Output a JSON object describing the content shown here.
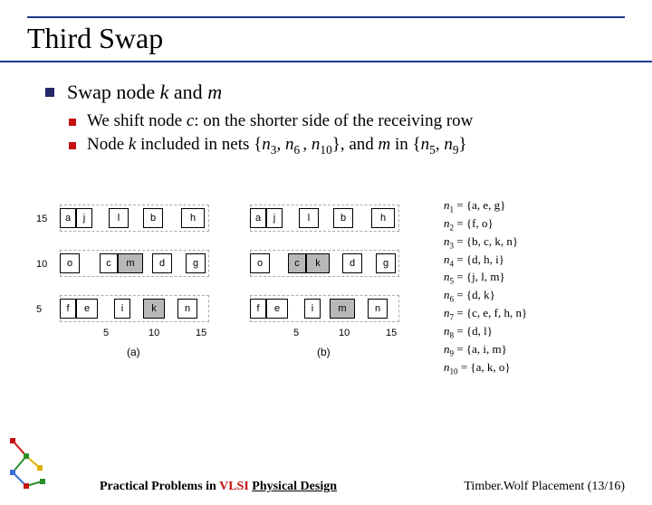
{
  "title": "Third Swap",
  "main_bullet": {
    "prefix": "Swap node ",
    "k": "k",
    "and": " and ",
    "m": "m"
  },
  "sub_bullets": [
    {
      "prefix": "We shift node ",
      "c": "c",
      "rest": ": on the shorter side of the receiving row"
    },
    {
      "p1": "Node ",
      "k": "k",
      "p2": " included in nets {",
      "n3": "n",
      "s3": "3",
      "c1": ", ",
      "n6": "n",
      "s6": "6 ",
      "c2": ", ",
      "n10": "n",
      "s10": "10",
      "p3": "}, and ",
      "m": "m",
      "p4": " in {",
      "n5": "n",
      "s5": "5",
      "c3": ", ",
      "n9": "n",
      "s9": "9",
      "p5": "}"
    }
  ],
  "axis": {
    "y15": "15",
    "y10": "10",
    "y5": "5",
    "x5": "5",
    "x10": "10",
    "x15": "15"
  },
  "nodes_a": {
    "r1": [
      "a",
      "j",
      "l",
      "b",
      "h"
    ],
    "r2": [
      "o",
      "c",
      "m",
      "d",
      "g"
    ],
    "r3": [
      "f",
      "e",
      "i",
      "k",
      "n"
    ]
  },
  "nodes_b": {
    "r1": [
      "a",
      "j",
      "l",
      "b",
      "h"
    ],
    "r2": [
      "o",
      "c",
      "k",
      "d",
      "g"
    ],
    "r3": [
      "f",
      "e",
      "i",
      "m",
      "n"
    ]
  },
  "captions": {
    "a": "(a)",
    "b": "(b)"
  },
  "netlist": {
    "n1": "n",
    "s1": "1",
    "e1": " = {a, e, g}",
    "n2": "n",
    "s2": "2",
    "e2": " = {f, o}",
    "n3": "n",
    "s3": "3",
    "e3": " = {b, c, k, n}",
    "n4": "n",
    "s4": "4",
    "e4": " = {d, h, i}",
    "n5": "n",
    "s5": "5",
    "e5": " = {j, l, m}",
    "n6": "n",
    "s6": "6",
    "e6": " = {d, k}",
    "n7": "n",
    "s7": "7",
    "e7": " = {c, e, f, h, n}",
    "n8": "n",
    "s8": "8",
    "e8": " = {d, l}",
    "n9": "n",
    "s9": "9",
    "e9": " = {a, i, m}",
    "n10": "n",
    "s10": "10",
    "e10": " = {a, k, o}"
  },
  "footer": {
    "left_b1": "Practical Problems in ",
    "vlsi": "VLSI",
    "space": " ",
    "phys": "Physical Design",
    "right": "Timber.Wolf Placement (13/16)"
  }
}
